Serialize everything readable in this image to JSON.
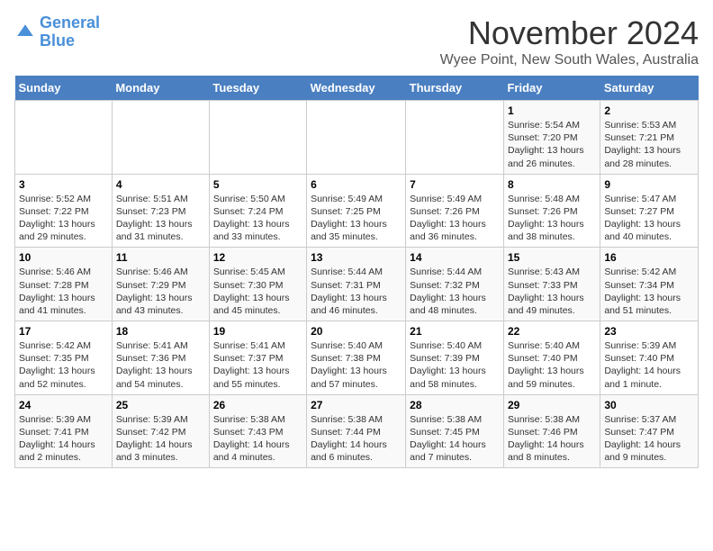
{
  "logo": {
    "line1": "General",
    "line2": "Blue"
  },
  "title": "November 2024",
  "subtitle": "Wyee Point, New South Wales, Australia",
  "days_of_week": [
    "Sunday",
    "Monday",
    "Tuesday",
    "Wednesday",
    "Thursday",
    "Friday",
    "Saturday"
  ],
  "weeks": [
    [
      {
        "day": "",
        "info": ""
      },
      {
        "day": "",
        "info": ""
      },
      {
        "day": "",
        "info": ""
      },
      {
        "day": "",
        "info": ""
      },
      {
        "day": "",
        "info": ""
      },
      {
        "day": "1",
        "info": "Sunrise: 5:54 AM\nSunset: 7:20 PM\nDaylight: 13 hours and 26 minutes."
      },
      {
        "day": "2",
        "info": "Sunrise: 5:53 AM\nSunset: 7:21 PM\nDaylight: 13 hours and 28 minutes."
      }
    ],
    [
      {
        "day": "3",
        "info": "Sunrise: 5:52 AM\nSunset: 7:22 PM\nDaylight: 13 hours and 29 minutes."
      },
      {
        "day": "4",
        "info": "Sunrise: 5:51 AM\nSunset: 7:23 PM\nDaylight: 13 hours and 31 minutes."
      },
      {
        "day": "5",
        "info": "Sunrise: 5:50 AM\nSunset: 7:24 PM\nDaylight: 13 hours and 33 minutes."
      },
      {
        "day": "6",
        "info": "Sunrise: 5:49 AM\nSunset: 7:25 PM\nDaylight: 13 hours and 35 minutes."
      },
      {
        "day": "7",
        "info": "Sunrise: 5:49 AM\nSunset: 7:26 PM\nDaylight: 13 hours and 36 minutes."
      },
      {
        "day": "8",
        "info": "Sunrise: 5:48 AM\nSunset: 7:26 PM\nDaylight: 13 hours and 38 minutes."
      },
      {
        "day": "9",
        "info": "Sunrise: 5:47 AM\nSunset: 7:27 PM\nDaylight: 13 hours and 40 minutes."
      }
    ],
    [
      {
        "day": "10",
        "info": "Sunrise: 5:46 AM\nSunset: 7:28 PM\nDaylight: 13 hours and 41 minutes."
      },
      {
        "day": "11",
        "info": "Sunrise: 5:46 AM\nSunset: 7:29 PM\nDaylight: 13 hours and 43 minutes."
      },
      {
        "day": "12",
        "info": "Sunrise: 5:45 AM\nSunset: 7:30 PM\nDaylight: 13 hours and 45 minutes."
      },
      {
        "day": "13",
        "info": "Sunrise: 5:44 AM\nSunset: 7:31 PM\nDaylight: 13 hours and 46 minutes."
      },
      {
        "day": "14",
        "info": "Sunrise: 5:44 AM\nSunset: 7:32 PM\nDaylight: 13 hours and 48 minutes."
      },
      {
        "day": "15",
        "info": "Sunrise: 5:43 AM\nSunset: 7:33 PM\nDaylight: 13 hours and 49 minutes."
      },
      {
        "day": "16",
        "info": "Sunrise: 5:42 AM\nSunset: 7:34 PM\nDaylight: 13 hours and 51 minutes."
      }
    ],
    [
      {
        "day": "17",
        "info": "Sunrise: 5:42 AM\nSunset: 7:35 PM\nDaylight: 13 hours and 52 minutes."
      },
      {
        "day": "18",
        "info": "Sunrise: 5:41 AM\nSunset: 7:36 PM\nDaylight: 13 hours and 54 minutes."
      },
      {
        "day": "19",
        "info": "Sunrise: 5:41 AM\nSunset: 7:37 PM\nDaylight: 13 hours and 55 minutes."
      },
      {
        "day": "20",
        "info": "Sunrise: 5:40 AM\nSunset: 7:38 PM\nDaylight: 13 hours and 57 minutes."
      },
      {
        "day": "21",
        "info": "Sunrise: 5:40 AM\nSunset: 7:39 PM\nDaylight: 13 hours and 58 minutes."
      },
      {
        "day": "22",
        "info": "Sunrise: 5:40 AM\nSunset: 7:40 PM\nDaylight: 13 hours and 59 minutes."
      },
      {
        "day": "23",
        "info": "Sunrise: 5:39 AM\nSunset: 7:40 PM\nDaylight: 14 hours and 1 minute."
      }
    ],
    [
      {
        "day": "24",
        "info": "Sunrise: 5:39 AM\nSunset: 7:41 PM\nDaylight: 14 hours and 2 minutes."
      },
      {
        "day": "25",
        "info": "Sunrise: 5:39 AM\nSunset: 7:42 PM\nDaylight: 14 hours and 3 minutes."
      },
      {
        "day": "26",
        "info": "Sunrise: 5:38 AM\nSunset: 7:43 PM\nDaylight: 14 hours and 4 minutes."
      },
      {
        "day": "27",
        "info": "Sunrise: 5:38 AM\nSunset: 7:44 PM\nDaylight: 14 hours and 6 minutes."
      },
      {
        "day": "28",
        "info": "Sunrise: 5:38 AM\nSunset: 7:45 PM\nDaylight: 14 hours and 7 minutes."
      },
      {
        "day": "29",
        "info": "Sunrise: 5:38 AM\nSunset: 7:46 PM\nDaylight: 14 hours and 8 minutes."
      },
      {
        "day": "30",
        "info": "Sunrise: 5:37 AM\nSunset: 7:47 PM\nDaylight: 14 hours and 9 minutes."
      }
    ]
  ]
}
